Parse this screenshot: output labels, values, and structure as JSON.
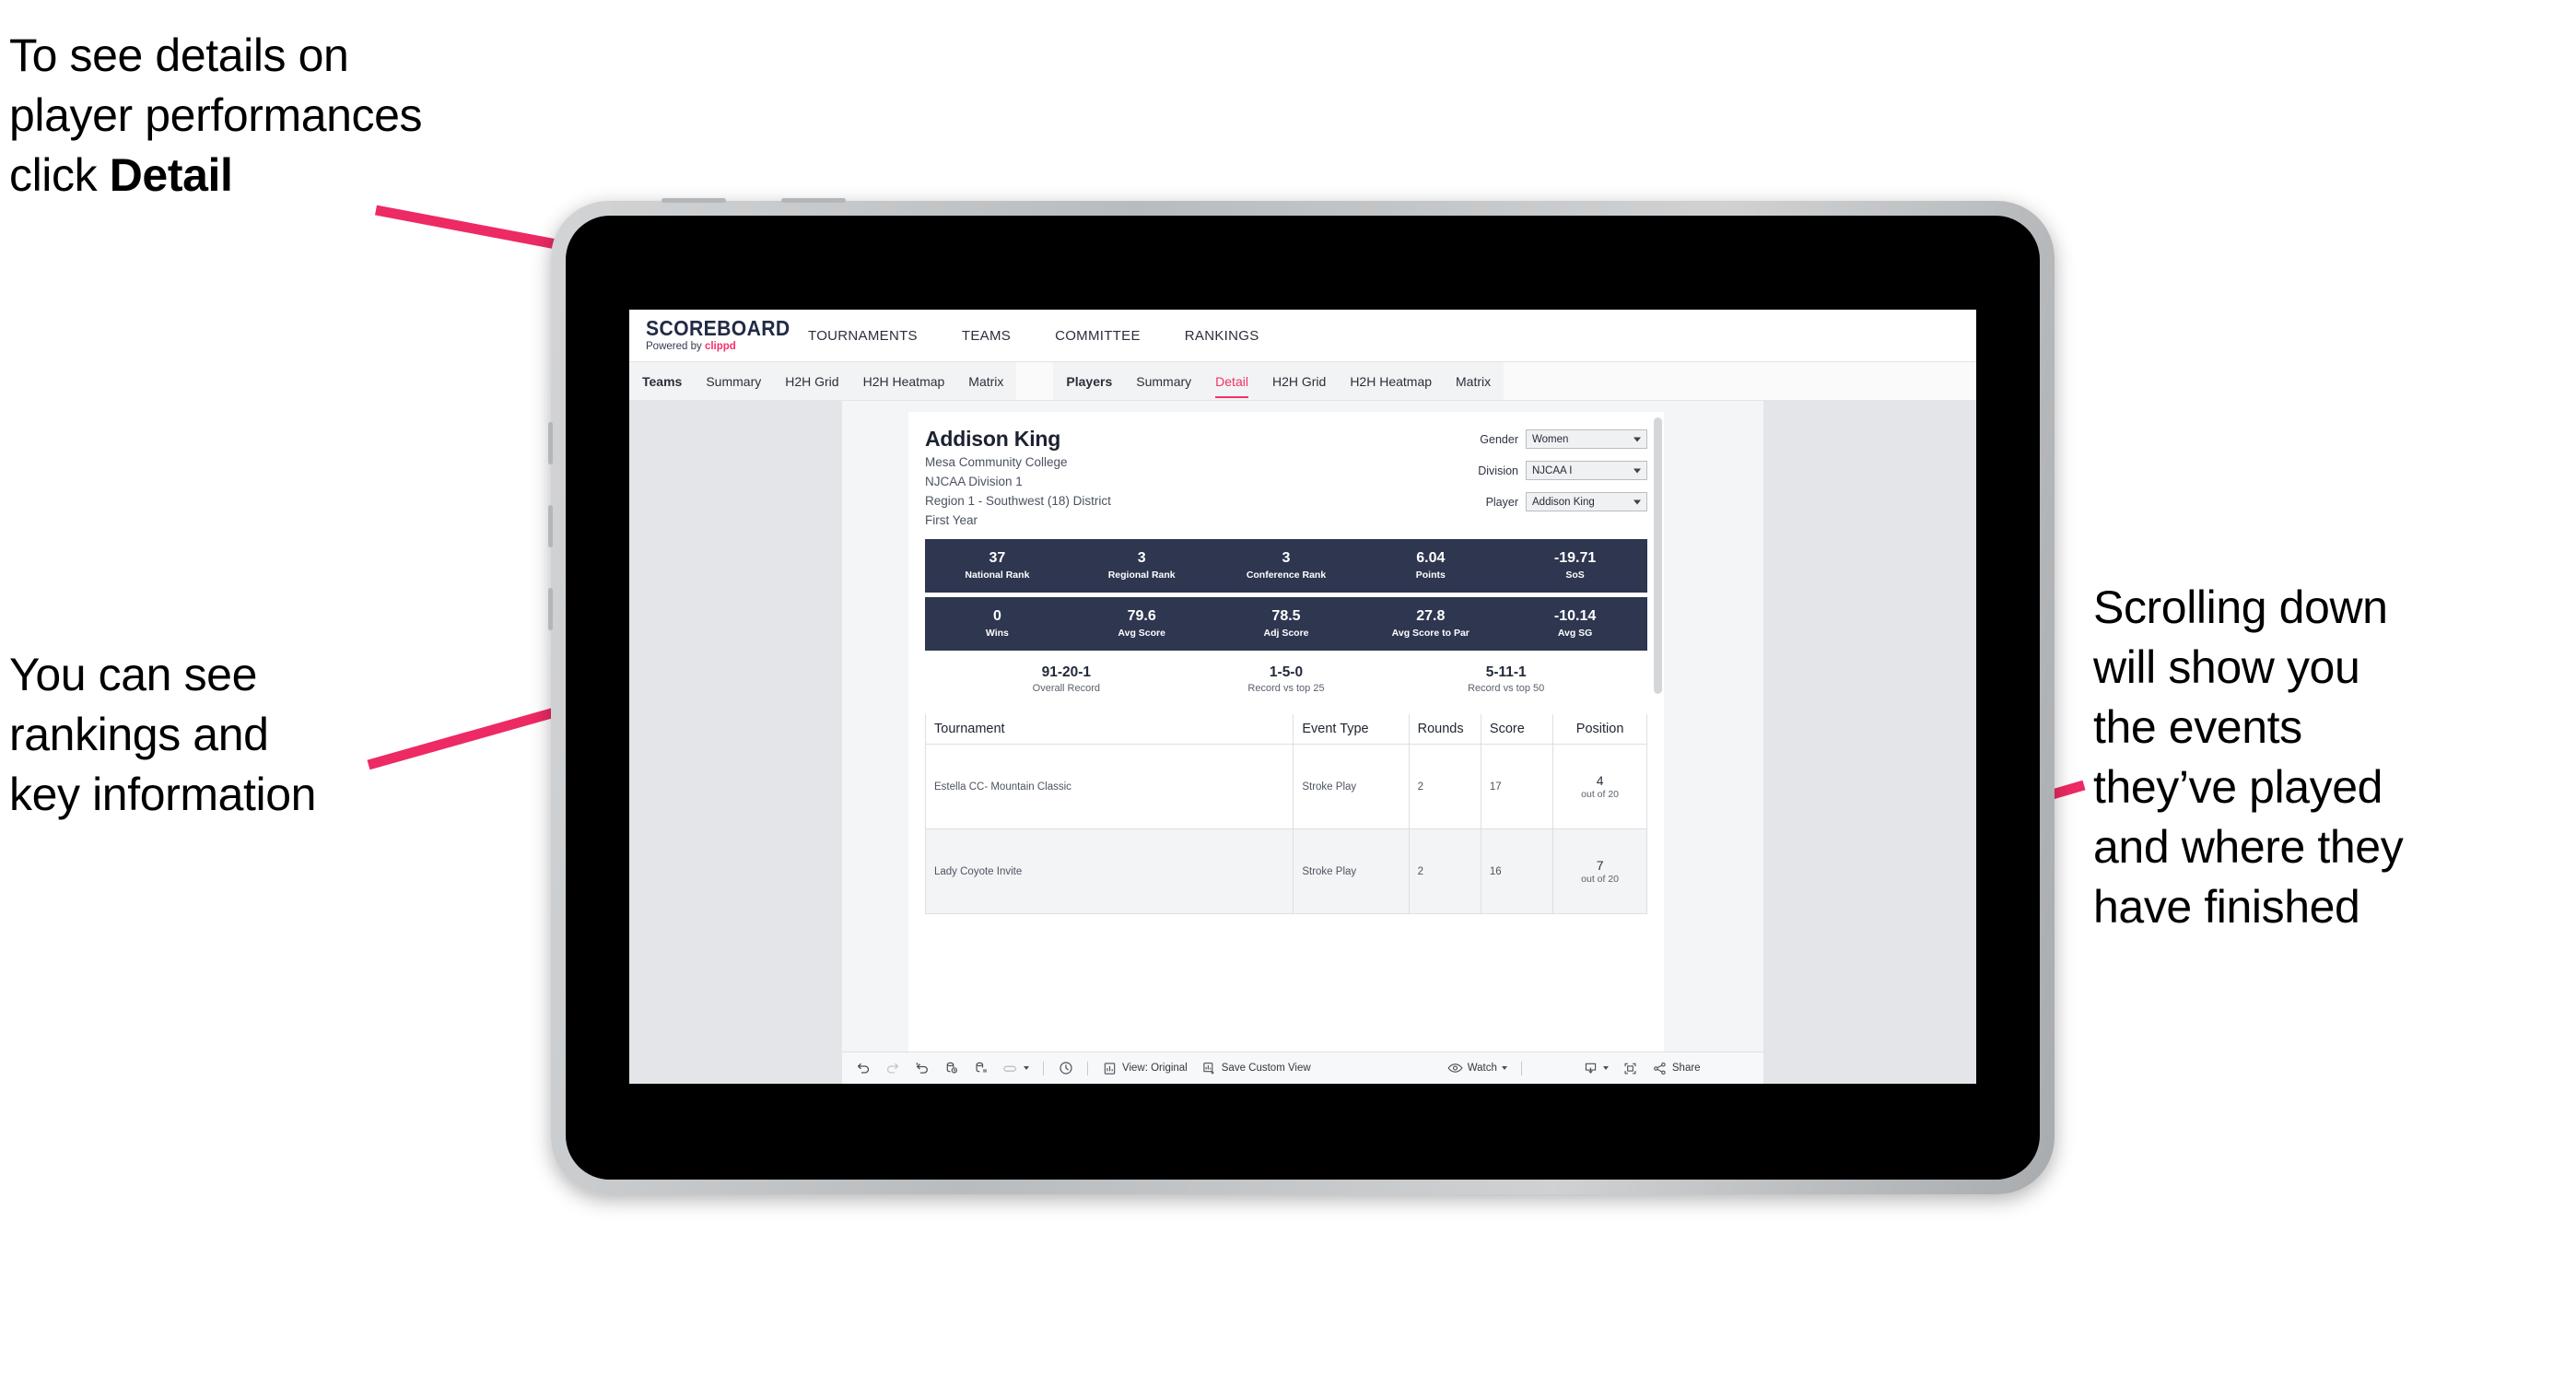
{
  "annotations": {
    "top_left": "To see details on\nplayer performances\nclick ",
    "top_left_bold": "Detail",
    "left": "You can see\nrankings and\nkey information",
    "right": "Scrolling down\nwill show you\nthe events\nthey’ve played\nand where they\nhave finished",
    "arrow_color": "#ED2A63"
  },
  "app": {
    "logo": {
      "main": "SCOREBOARD",
      "powered": "Powered by ",
      "brand": "clippd"
    },
    "topnav": [
      "TOURNAMENTS",
      "TEAMS",
      "COMMITTEE",
      "RANKINGS"
    ],
    "tabs_teams": {
      "head": "Teams",
      "items": [
        "Summary",
        "H2H Grid",
        "H2H Heatmap",
        "Matrix"
      ]
    },
    "tabs_players": {
      "head": "Players",
      "items": [
        "Summary",
        "Detail",
        "H2H Grid",
        "H2H Heatmap",
        "Matrix"
      ],
      "active": "Detail"
    }
  },
  "player": {
    "name": "Addison King",
    "meta": [
      "Mesa Community College",
      "NJCAA Division 1",
      "Region 1 - Southwest (18) District",
      "First Year"
    ]
  },
  "filters": [
    {
      "label": "Gender",
      "value": "Women"
    },
    {
      "label": "Division",
      "value": "NJCAA I"
    },
    {
      "label": "Player",
      "value": "Addison King"
    }
  ],
  "stats_row1": [
    {
      "value": "37",
      "label": "National Rank"
    },
    {
      "value": "3",
      "label": "Regional Rank"
    },
    {
      "value": "3",
      "label": "Conference Rank"
    },
    {
      "value": "6.04",
      "label": "Points"
    },
    {
      "value": "-19.71",
      "label": "SoS"
    }
  ],
  "stats_row2": [
    {
      "value": "0",
      "label": "Wins"
    },
    {
      "value": "79.6",
      "label": "Avg Score"
    },
    {
      "value": "78.5",
      "label": "Adj Score"
    },
    {
      "value": "27.8",
      "label": "Avg Score to Par"
    },
    {
      "value": "-10.14",
      "label": "Avg SG"
    }
  ],
  "records": [
    {
      "value": "91-20-1",
      "label": "Overall Record"
    },
    {
      "value": "1-5-0",
      "label": "Record vs top 25"
    },
    {
      "value": "5-11-1",
      "label": "Record vs top 50"
    }
  ],
  "table": {
    "columns": [
      "Tournament",
      "Event Type",
      "Rounds",
      "Score",
      "Position"
    ],
    "rows": [
      {
        "tournament": "Estella CC- Mountain Classic",
        "event_type": "Stroke Play",
        "rounds": "2",
        "score": "17",
        "position": "4",
        "out_of": "out of 20"
      },
      {
        "tournament": "Lady Coyote Invite",
        "event_type": "Stroke Play",
        "rounds": "2",
        "score": "16",
        "position": "7",
        "out_of": "out of 20"
      }
    ]
  },
  "toolbar": {
    "view_label": "View: Original",
    "save_label": "Save Custom View",
    "watch_label": "Watch",
    "share_label": "Share"
  }
}
